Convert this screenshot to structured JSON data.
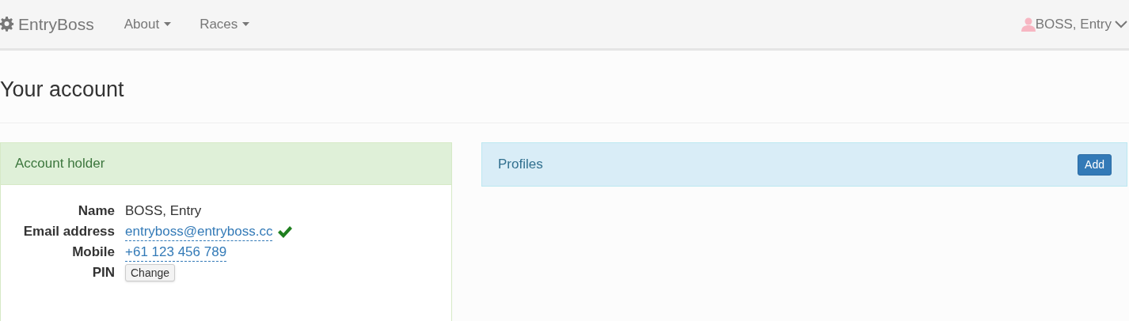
{
  "navbar": {
    "brand": "EntryBoss",
    "menus": [
      {
        "label": "About"
      },
      {
        "label": "Races"
      }
    ],
    "user": "BOSS, Entry"
  },
  "heading": "Your account",
  "account_panel": {
    "title": "Account holder",
    "rows": [
      {
        "kind": "text",
        "label": "Name",
        "value": "BOSS, Entry"
      },
      {
        "kind": "link",
        "label": "Email address",
        "value": "entryboss@entryboss.cc",
        "verified": true
      },
      {
        "kind": "link",
        "label": "Mobile",
        "value": "+61 123 456 789",
        "verified": false
      },
      {
        "kind": "button",
        "label": "PIN",
        "value": "Change"
      }
    ]
  },
  "profiles_panel": {
    "title": "Profiles",
    "button": "Add"
  }
}
